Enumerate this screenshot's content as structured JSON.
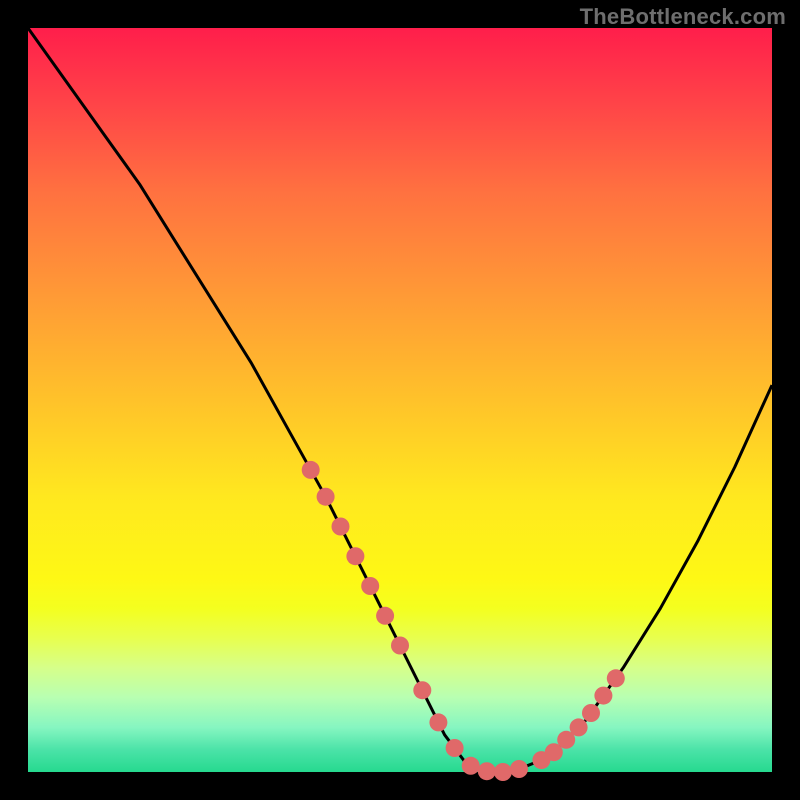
{
  "watermark": "TheBottleneck.com",
  "chart_data": {
    "type": "line",
    "title": "",
    "xlabel": "",
    "ylabel": "",
    "xlim": [
      0,
      100
    ],
    "ylim": [
      0,
      100
    ],
    "grid": false,
    "legend": false,
    "series": [
      {
        "name": "bottleneck-curve",
        "x": [
          0,
          5,
          10,
          15,
          20,
          25,
          30,
          35,
          40,
          45,
          50,
          53,
          56,
          59,
          62,
          65,
          70,
          75,
          80,
          85,
          90,
          95,
          100
        ],
        "y": [
          100,
          93,
          86,
          79,
          71,
          63,
          55,
          46,
          37,
          27,
          17,
          11,
          5,
          1,
          0,
          0,
          2,
          7,
          14,
          22,
          31,
          41,
          52
        ]
      }
    ],
    "highlight_segments": [
      {
        "name": "left-dots",
        "x_range": [
          38,
          50
        ],
        "dot_count": 7
      },
      {
        "name": "flat-dots",
        "x_range": [
          53,
          66
        ],
        "dot_count": 7
      },
      {
        "name": "right-dots",
        "x_range": [
          69,
          79
        ],
        "dot_count": 7
      }
    ],
    "colors": {
      "curve": "#000000",
      "dots": "#e06969",
      "gradient_top": "#ff1e4b",
      "gradient_bottom": "#26d98f"
    }
  }
}
